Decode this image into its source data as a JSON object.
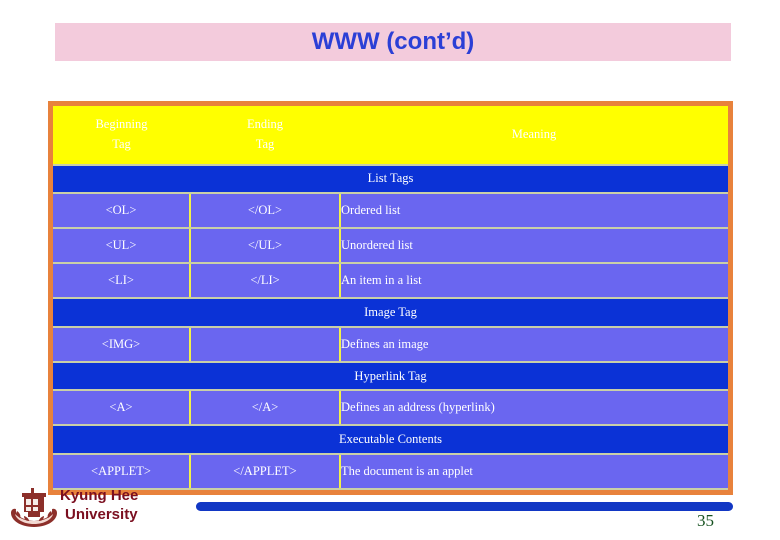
{
  "slide": {
    "title": "WWW (cont’d)",
    "page_number": "35",
    "title_color": "#2B3FD6",
    "banner_color": "#F3CBDC",
    "table_border_color": "#E8823C",
    "header_bg_color": "#FFFF00",
    "section_bg_color": "#0B32D6",
    "row_bg_color": "#6A66F0",
    "gridline_color": "#F2F24A"
  },
  "table": {
    "headers": {
      "beginning_tag_line1": "Beginning",
      "beginning_tag_line2": "Tag",
      "ending_tag_line1": "Ending",
      "ending_tag_line2": "Tag",
      "meaning": "Meaning"
    },
    "sections": [
      {
        "label": "List Tags",
        "rows": [
          {
            "begin": "<OL>",
            "end": "</OL>",
            "meaning": "Ordered list"
          },
          {
            "begin": "<UL>",
            "end": "</UL>",
            "meaning": "Unordered list"
          },
          {
            "begin": "<LI>",
            "end": "</LI>",
            "meaning": "An item in a list"
          }
        ]
      },
      {
        "label": "Image Tag",
        "rows": [
          {
            "begin": "<IMG>",
            "end": "",
            "meaning": "Defines an image"
          }
        ]
      },
      {
        "label": "Hyperlink Tag",
        "rows": [
          {
            "begin": "<A>",
            "end": "</A>",
            "meaning": "Defines an address (hyperlink)"
          }
        ]
      },
      {
        "label": "Executable Contents",
        "rows": [
          {
            "begin": "<APPLET>",
            "end": "</APPLET>",
            "meaning": "The document is an applet"
          }
        ]
      }
    ]
  },
  "footer": {
    "university_line1": "Kyung Hee",
    "university_line2": "University",
    "logo_icon": "university-crest-icon",
    "text_color": "#7B0F20",
    "bar_color": "#1237C4"
  }
}
